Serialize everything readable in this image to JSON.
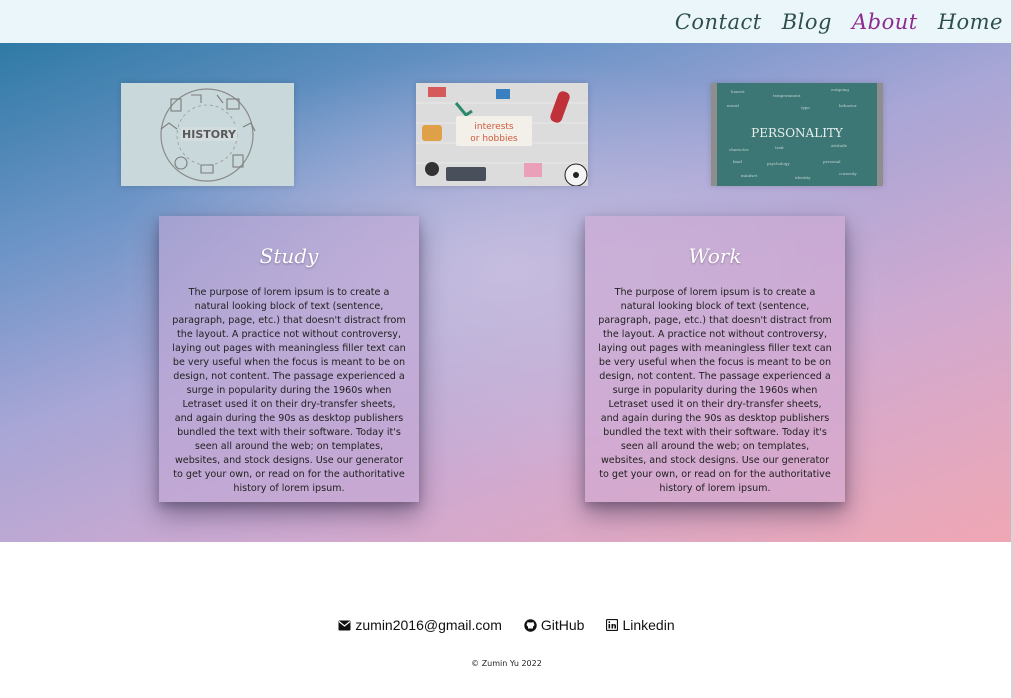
{
  "nav": {
    "items": [
      {
        "label": "Contact",
        "active": false
      },
      {
        "label": "Blog",
        "active": false
      },
      {
        "label": "About",
        "active": true
      },
      {
        "label": "Home",
        "active": false
      }
    ]
  },
  "hero": {
    "images": [
      {
        "name": "history-image",
        "caption": "HISTORY"
      },
      {
        "name": "interests-hobbies-image",
        "caption_line1": "interests",
        "caption_line2": "or hobbies"
      },
      {
        "name": "personality-image",
        "caption": "PERSONALITY"
      }
    ],
    "cards": [
      {
        "title": "Study",
        "text": "The purpose of lorem ipsum is to create a natural looking block of text (sentence, paragraph, page, etc.) that doesn't distract from the layout. A practice not without controversy, laying out pages with meaningless filler text can be very useful when the focus is meant to be on design, not content. The passage experienced a surge in popularity during the 1960s when Letraset used it on their dry-transfer sheets, and again during the 90s as desktop publishers bundled the text with their software. Today it's seen all around the web; on templates, websites, and stock designs. Use our generator to get your own, or read on for the authoritative history of lorem ipsum."
      },
      {
        "title": "Work",
        "text": "The purpose of lorem ipsum is to create a natural looking block of text (sentence, paragraph, page, etc.) that doesn't distract from the layout. A practice not without controversy, laying out pages with meaningless filler text can be very useful when the focus is meant to be on design, not content. The passage experienced a surge in popularity during the 1960s when Letraset used it on their dry-transfer sheets, and again during the 90s as desktop publishers bundled the text with their software. Today it's seen all around the web; on templates, websites, and stock designs. Use our generator to get your own, or read on for the authoritative history of lorem ipsum."
      }
    ]
  },
  "footer": {
    "links": [
      {
        "icon": "envelope-icon",
        "label": "zumin2016@gmail.com"
      },
      {
        "icon": "github-icon",
        "label": "GitHub"
      },
      {
        "icon": "linkedin-icon",
        "label": "Linkedin"
      }
    ],
    "copyright": "© Zumin Yu 2022"
  },
  "colors": {
    "nav_bg": "#ebf6fb",
    "nav_text": "#2f4f4f",
    "nav_active": "#8d2c8d",
    "hero_gradient_start": "#2f7aa6",
    "hero_gradient_end": "#f0a7b4"
  }
}
